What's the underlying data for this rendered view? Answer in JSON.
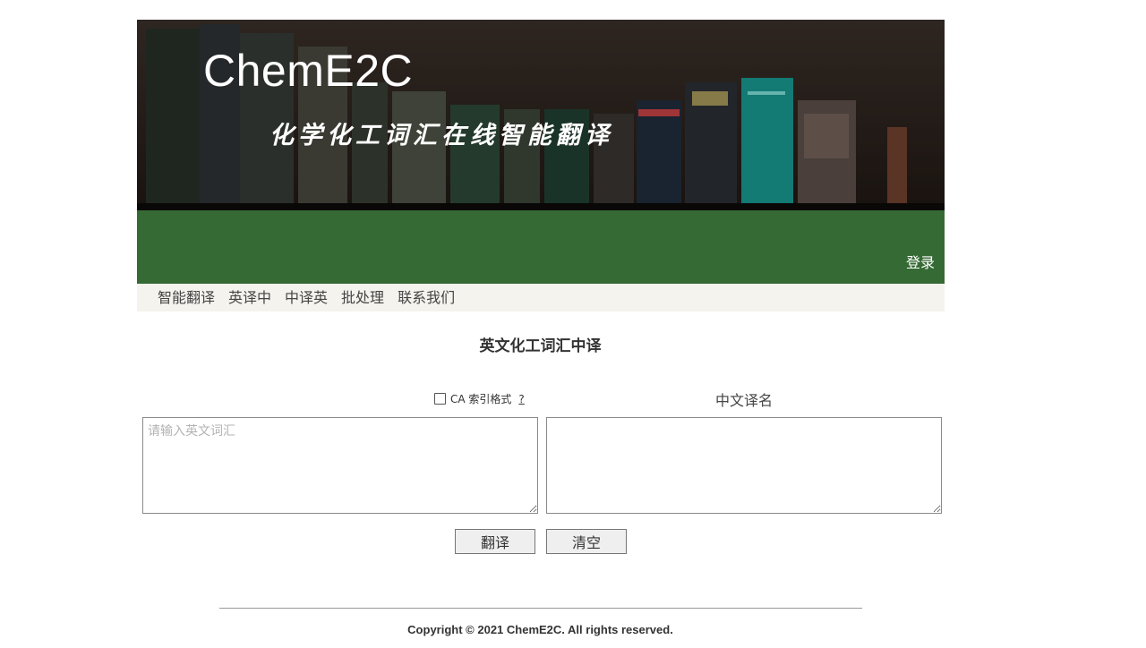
{
  "header": {
    "site_title": "ChemE2C",
    "subtitle": "化学化工词汇在线智能翻译",
    "login_label": "登录",
    "banner_colors": {
      "green_bar": "#356a34"
    }
  },
  "nav": {
    "items": [
      {
        "label": "智能翻译"
      },
      {
        "label": "英译中"
      },
      {
        "label": "中译英"
      },
      {
        "label": "批处理"
      },
      {
        "label": "联系我们"
      }
    ]
  },
  "main": {
    "title": "英文化工词汇中译",
    "ca_option": {
      "label": "CA 索引格式",
      "help": "?",
      "checked": false
    },
    "output_label": "中文译名",
    "input": {
      "placeholder": "请输入英文词汇",
      "value": ""
    },
    "output": {
      "value": ""
    },
    "translate_button": "翻译",
    "clear_button": "清空"
  },
  "footer": {
    "copyright": "Copyright © 2021 ChemE2C. All rights reserved."
  }
}
